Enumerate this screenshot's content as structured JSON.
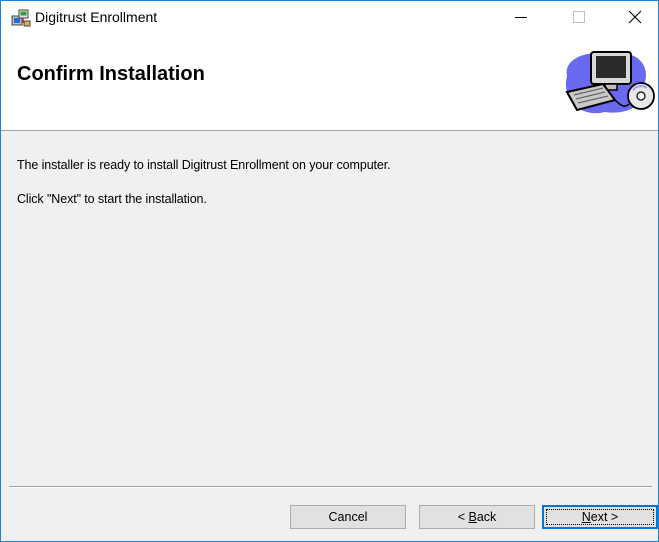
{
  "window": {
    "title": "Digitrust Enrollment",
    "app_icon": "installer-package-icon",
    "accent_color": "#1883d7",
    "controls": {
      "minimize_icon": "minimize-icon",
      "maximize_icon": "maximize-icon",
      "close_icon": "close-icon"
    }
  },
  "banner": {
    "title": "Confirm Installation",
    "graphic": "computer-setup-graphic"
  },
  "content": {
    "message_1": "The installer is ready to install Digitrust Enrollment on your computer.",
    "message_2": "Click \"Next\" to start the installation."
  },
  "buttons": {
    "cancel": "Cancel",
    "back_prefix": "< ",
    "back_mnemonic": "B",
    "back_rest": "ack",
    "next_mnemonic": "N",
    "next_rest": "ext >",
    "default_button_border": "#0078d7"
  }
}
